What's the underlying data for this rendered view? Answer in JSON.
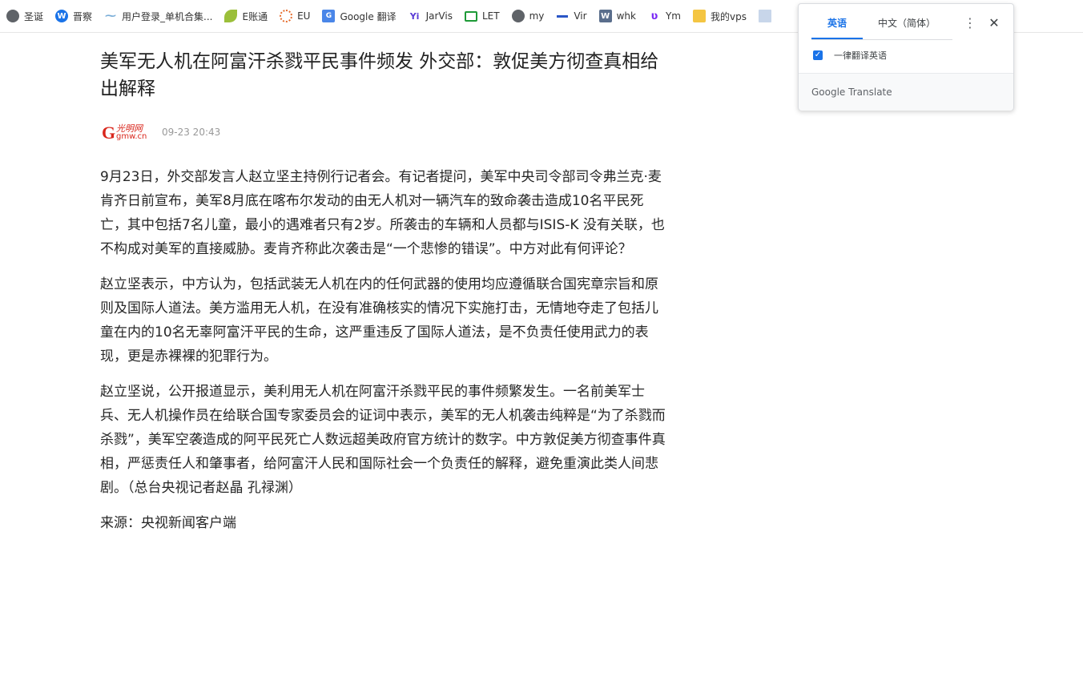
{
  "bookmarks": [
    {
      "icon": "globe-icon",
      "label": "圣诞"
    },
    {
      "icon": "w-icon",
      "label": "晋察"
    },
    {
      "icon": "dash-icon",
      "label": "用户登录_单机合集..."
    },
    {
      "icon": "leaf-icon",
      "label": "E账通"
    },
    {
      "icon": "ring-icon",
      "label": "EU"
    },
    {
      "icon": "google-translate-icon",
      "label": "Google 翻译"
    },
    {
      "icon": "yiji-icon",
      "label": "JarVis"
    },
    {
      "icon": "monitor-icon",
      "label": "LET"
    },
    {
      "icon": "globe-icon",
      "label": "my"
    },
    {
      "icon": "bars-icon",
      "label": "Vir"
    },
    {
      "icon": "w-square-icon",
      "label": "whk"
    },
    {
      "icon": "ym-icon",
      "label": "Ym"
    },
    {
      "icon": "folder-icon",
      "label": "我的vps"
    }
  ],
  "article": {
    "title": "美军无人机在阿富汗杀戮平民事件频发 外交部：敦促美方彻查真相给出解释",
    "source_logo": {
      "cn": "光明网",
      "domain": "gmw.cn"
    },
    "date": "09-23 20:43",
    "paragraphs": [
      "9月23日，外交部发言人赵立坚主持例行记者会。有记者提问，美军中央司令部司令弗兰克·麦肯齐日前宣布，美军8月底在喀布尔发动的由无人机对一辆汽车的致命袭击造成10名平民死亡，其中包括7名儿童，最小的遇难者只有2岁。所袭击的车辆和人员都与ISIS-K 没有关联，也不构成对美军的直接威胁。麦肯齐称此次袭击是“一个悲惨的错误”。中方对此有何评论？",
      "赵立坚表示，中方认为，包括武装无人机在内的任何武器的使用均应遵循联合国宪章宗旨和原则及国际人道法。美方滥用无人机，在没有准确核实的情况下实施打击，无情地夺走了包括儿童在内的10名无辜阿富汗平民的生命，这严重违反了国际人道法，是不负责任使用武力的表现，更是赤裸裸的犯罪行为。",
      "赵立坚说，公开报道显示，美利用无人机在阿富汗杀戮平民的事件频繁发生。一名前美军士兵、无人机操作员在给联合国专家委员会的证词中表示，美军的无人机袭击纯粹是“为了杀戮而杀戮”，美军空袭造成的阿平民死亡人数远超美政府官方统计的数字。中方敦促美方彻查事件真相，严惩责任人和肇事者，给阿富汗人民和国际社会一个负责任的解释，避免重演此类人间悲剧。（总台央视记者赵晶 孔禄渊）",
      "来源：央视新闻客户端"
    ]
  },
  "translate_popup": {
    "tabs": [
      "英语",
      "中文（简体）"
    ],
    "active_tab": "英语",
    "menu_icon": "more-vert-icon",
    "close_icon": "close-icon",
    "checkbox_label": "一律翻译英语",
    "checkbox_checked": true,
    "brand_google": "Google",
    "brand_product": "Translate"
  }
}
